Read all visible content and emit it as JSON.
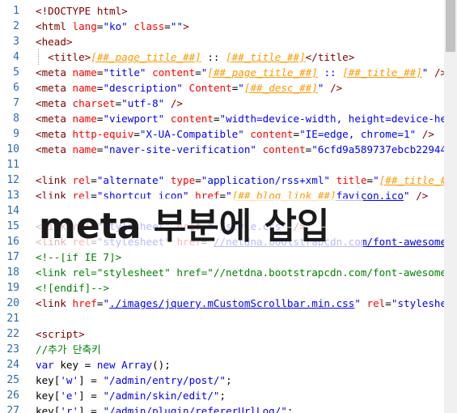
{
  "editor": {
    "lines": [
      {
        "number": "1",
        "segments": [
          [
            "tag",
            "<!DOCTYPE html>"
          ]
        ]
      },
      {
        "number": "2",
        "segments": [
          [
            "tag",
            "<html "
          ],
          [
            "attr",
            "lang"
          ],
          [
            "txt",
            "="
          ],
          [
            "val",
            "\"ko\""
          ],
          [
            "txt",
            " "
          ],
          [
            "attr",
            "class"
          ],
          [
            "txt",
            "="
          ],
          [
            "val",
            "\"\""
          ],
          [
            "tag",
            ">"
          ]
        ]
      },
      {
        "number": "3",
        "segments": [
          [
            "tag",
            "<head>"
          ]
        ]
      },
      {
        "number": "4",
        "segments": [
          [
            "txt",
            "  "
          ],
          [
            "tag",
            "<title>"
          ],
          [
            "tpl",
            "[##_page_title_##]"
          ],
          [
            "txt",
            " :: "
          ],
          [
            "tpl",
            "[##_title_##]"
          ],
          [
            "tag",
            "</title>"
          ]
        ]
      },
      {
        "number": "5",
        "segments": [
          [
            "tag",
            "<meta "
          ],
          [
            "attr",
            "name"
          ],
          [
            "txt",
            "="
          ],
          [
            "val",
            "\"title\""
          ],
          [
            "txt",
            " "
          ],
          [
            "attr",
            "content"
          ],
          [
            "txt",
            "="
          ],
          [
            "val",
            "\""
          ],
          [
            "tpl",
            "[##_page_title_##]"
          ],
          [
            "val",
            " :: "
          ],
          [
            "tpl",
            "[##_title_##]"
          ],
          [
            "val",
            "\""
          ],
          [
            "txt",
            " "
          ],
          [
            "tag",
            "/>"
          ]
        ]
      },
      {
        "number": "6",
        "segments": [
          [
            "tag",
            "<meta "
          ],
          [
            "attr",
            "name"
          ],
          [
            "txt",
            "="
          ],
          [
            "val",
            "\"description\""
          ],
          [
            "txt",
            " "
          ],
          [
            "attr",
            "Content"
          ],
          [
            "txt",
            "="
          ],
          [
            "val",
            "\""
          ],
          [
            "tpl",
            "[##_desc_##]"
          ],
          [
            "val",
            "\""
          ],
          [
            "txt",
            " "
          ],
          [
            "tag",
            "/>"
          ]
        ]
      },
      {
        "number": "7",
        "segments": [
          [
            "tag",
            "<meta "
          ],
          [
            "attr",
            "charset"
          ],
          [
            "txt",
            "="
          ],
          [
            "val",
            "\"utf-8\""
          ],
          [
            "txt",
            " "
          ],
          [
            "tag",
            "/>"
          ]
        ]
      },
      {
        "number": "8",
        "segments": [
          [
            "tag",
            "<meta "
          ],
          [
            "attr",
            "name"
          ],
          [
            "txt",
            "="
          ],
          [
            "val",
            "\"viewport\""
          ],
          [
            "txt",
            " "
          ],
          [
            "attr",
            "content"
          ],
          [
            "txt",
            "="
          ],
          [
            "val",
            "\"width=device-width, height=device-hei"
          ]
        ]
      },
      {
        "number": "9",
        "segments": [
          [
            "tag",
            "<meta "
          ],
          [
            "attr",
            "http-equiv"
          ],
          [
            "txt",
            "="
          ],
          [
            "val",
            "\"X-UA-Compatible\""
          ],
          [
            "txt",
            " "
          ],
          [
            "attr",
            "content"
          ],
          [
            "txt",
            "="
          ],
          [
            "val",
            "\"IE=edge, chrome=1\""
          ],
          [
            "txt",
            " "
          ],
          [
            "tag",
            "/>"
          ]
        ]
      },
      {
        "number": "10",
        "segments": [
          [
            "tag",
            "<meta "
          ],
          [
            "attr",
            "name"
          ],
          [
            "txt",
            "="
          ],
          [
            "val",
            "\"naver-site-verification\""
          ],
          [
            "txt",
            " "
          ],
          [
            "attr",
            "content"
          ],
          [
            "txt",
            "="
          ],
          [
            "val",
            "\"6cfd9a589737ebcb22944f"
          ]
        ]
      },
      {
        "number": "11",
        "segments": []
      },
      {
        "number": "12",
        "segments": [
          [
            "tag",
            "<link "
          ],
          [
            "attr",
            "rel"
          ],
          [
            "txt",
            "="
          ],
          [
            "val",
            "\"alternate\""
          ],
          [
            "txt",
            " "
          ],
          [
            "attr",
            "type"
          ],
          [
            "txt",
            "="
          ],
          [
            "val",
            "\"application/rss+xml\""
          ],
          [
            "txt",
            " "
          ],
          [
            "attr",
            "title"
          ],
          [
            "txt",
            "="
          ],
          [
            "val",
            "\""
          ],
          [
            "tpl",
            "[##_title_##"
          ]
        ]
      },
      {
        "number": "13",
        "segments": [
          [
            "tag",
            "<link "
          ],
          [
            "attr",
            "rel"
          ],
          [
            "txt",
            "="
          ],
          [
            "val",
            "\"shortcut icon\""
          ],
          [
            "txt",
            " "
          ],
          [
            "attr",
            "href"
          ],
          [
            "txt",
            "="
          ],
          [
            "val",
            "\""
          ],
          [
            "tpl",
            "[##_blog_link_##]"
          ],
          [
            "uval",
            "favicon.ico"
          ],
          [
            "val",
            "\""
          ],
          [
            "txt",
            " "
          ],
          [
            "tag",
            "/>"
          ]
        ]
      },
      {
        "number": "14",
        "segments": []
      },
      {
        "number": "15",
        "segments": [
          [
            "tag",
            "<link "
          ],
          [
            "attr",
            "rel"
          ],
          [
            "txt",
            "="
          ],
          [
            "val",
            "\"stylesheet\""
          ],
          [
            "txt",
            " "
          ],
          [
            "attr",
            "href"
          ],
          [
            "txt",
            "="
          ],
          [
            "val",
            "\"./style.css\""
          ],
          [
            "txt",
            " "
          ],
          [
            "tag",
            "/>"
          ]
        ]
      },
      {
        "number": "16",
        "segments": [
          [
            "tag",
            "<link "
          ],
          [
            "attr",
            "rel"
          ],
          [
            "txt",
            "="
          ],
          [
            "val",
            "\"stylesheet\""
          ],
          [
            "txt",
            " "
          ],
          [
            "attr",
            "href"
          ],
          [
            "txt",
            "="
          ],
          [
            "val",
            "\""
          ],
          [
            "uval",
            "//netdna.bootstrapcdn.com/font-awesome/"
          ]
        ]
      },
      {
        "number": "17",
        "segments": [
          [
            "cmt",
            "<!--[if IE 7]>"
          ]
        ]
      },
      {
        "number": "18",
        "segments": [
          [
            "cmt",
            "<link rel=\"stylesheet\" href=\"//netdna.bootstrapcdn.com/font-awesome/"
          ]
        ]
      },
      {
        "number": "19",
        "segments": [
          [
            "cmt",
            "<![endif]-->"
          ]
        ]
      },
      {
        "number": "20",
        "segments": [
          [
            "tag",
            "<link "
          ],
          [
            "attr",
            "href"
          ],
          [
            "txt",
            "="
          ],
          [
            "val",
            "\""
          ],
          [
            "uval",
            "./images/jquery.mCustomScrollbar.min.css"
          ],
          [
            "val",
            "\""
          ],
          [
            "txt",
            " "
          ],
          [
            "attr",
            "rel"
          ],
          [
            "txt",
            "="
          ],
          [
            "val",
            "\"styleshee"
          ]
        ]
      },
      {
        "number": "21",
        "segments": []
      },
      {
        "number": "22",
        "segments": [
          [
            "tag",
            "<script>"
          ]
        ]
      },
      {
        "number": "23",
        "segments": [
          [
            "cmt",
            "//추가 단축키"
          ]
        ]
      },
      {
        "number": "24",
        "segments": [
          [
            "kw",
            "var"
          ],
          [
            "txt",
            " key = "
          ],
          [
            "kw",
            "new"
          ],
          [
            "txt",
            " "
          ],
          [
            "kw",
            "Array"
          ],
          [
            "txt",
            "();"
          ]
        ]
      },
      {
        "number": "25",
        "segments": [
          [
            "txt",
            "key["
          ],
          [
            "val",
            "'w'"
          ],
          [
            "txt",
            "] = "
          ],
          [
            "val",
            "\"/admin/entry/post/\""
          ],
          [
            "txt",
            ";"
          ]
        ]
      },
      {
        "number": "26",
        "segments": [
          [
            "txt",
            "key["
          ],
          [
            "val",
            "'e'"
          ],
          [
            "txt",
            "] = "
          ],
          [
            "val",
            "\"/admin/skin/edit/\""
          ],
          [
            "txt",
            ";"
          ]
        ]
      },
      {
        "number": "27",
        "segments": [
          [
            "txt",
            "key["
          ],
          [
            "val",
            "'r'"
          ],
          [
            "txt",
            "] = "
          ],
          [
            "val",
            "\"/admin/plugin/refererUrlLog/\""
          ],
          [
            "txt",
            ";"
          ]
        ]
      }
    ]
  },
  "overlay": {
    "caption": "meta 부분에 삽입"
  }
}
